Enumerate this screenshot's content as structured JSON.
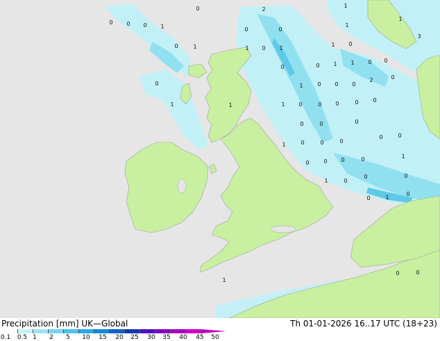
{
  "title_left": "Precipitation [mm]  UK—Global",
  "title_right": "Th 01-01-2026 16..17 UTC (18+23)",
  "legend": {
    "ticks": [
      "0.1",
      "0.5",
      "1",
      "2",
      "5",
      "10",
      "15",
      "20",
      "25",
      "30",
      "35",
      "40",
      "45",
      "50"
    ],
    "colors": [
      "#ffffff",
      "#c8f0f8",
      "#a0e4f4",
      "#78d4f0",
      "#50c0f0",
      "#28a8e8",
      "#1488dc",
      "#1060c8",
      "#1038b0",
      "#5010c0",
      "#8000c0",
      "#a800c0",
      "#d000c8"
    ],
    "arrow_color": "#c000c0"
  },
  "colors": {
    "land": "#c8f0a0",
    "sea": "#e6e6e6",
    "precip_light": "#c0f0f8",
    "precip_mid": "#90e0f0",
    "precip_heavy": "#60c8e8"
  },
  "map_points": [
    "0",
    "0",
    "0",
    "1",
    "0",
    "2",
    "1",
    "1",
    "0",
    "0",
    "0",
    "1",
    "1",
    "0",
    "1",
    "0",
    "1",
    "1",
    "3",
    "0",
    "1",
    "1",
    "0",
    "2",
    "0",
    "0",
    "0",
    "0",
    "1",
    "0",
    "0",
    "0",
    "1",
    "0",
    "0",
    "0",
    "0",
    "0",
    "1",
    "1",
    "0",
    "0",
    "0",
    "0",
    "0",
    "0",
    "1",
    "0",
    "0",
    "1",
    "0",
    "0",
    "0",
    "0",
    "1",
    "0",
    "0",
    "0",
    "1",
    "0",
    "0",
    "1",
    "0",
    "0"
  ]
}
